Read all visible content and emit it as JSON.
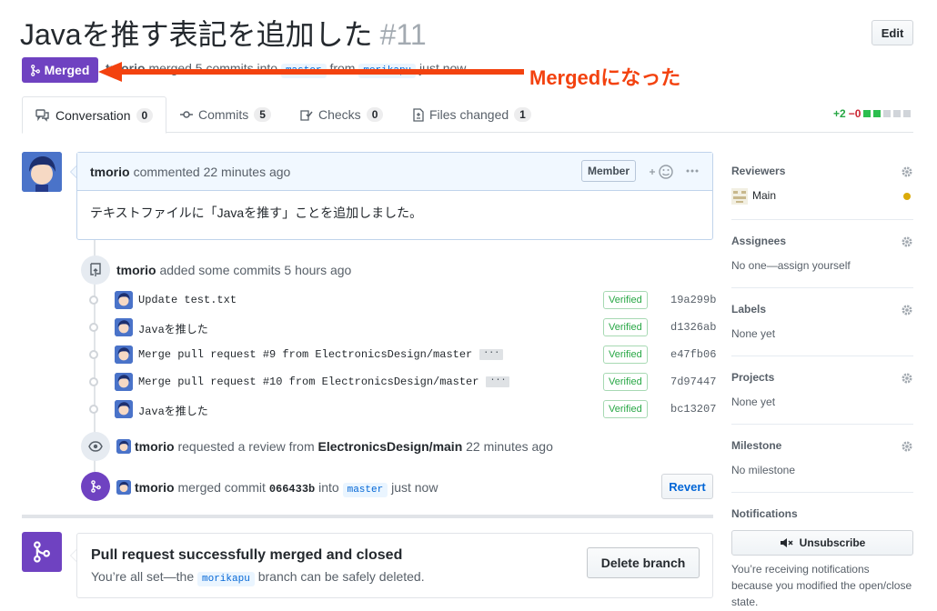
{
  "header": {
    "title": "Javaを推す表記を追加した",
    "number": "#11",
    "edit_label": "Edit",
    "state_label": "Merged",
    "meta": {
      "user": "tmorio",
      "action": "merged 5 commits into",
      "base_branch": "master",
      "from_word": "from",
      "head_branch": "morikapu",
      "time": "just now"
    }
  },
  "annotation": {
    "text": "Mergedになった",
    "color": "#f3420f"
  },
  "tabs": [
    {
      "label": "Conversation",
      "count": "0",
      "icon": "comment-discussion-icon"
    },
    {
      "label": "Commits",
      "count": "5",
      "icon": "git-commit-icon"
    },
    {
      "label": "Checks",
      "count": "0",
      "icon": "checklist-icon"
    },
    {
      "label": "Files changed",
      "count": "1",
      "icon": "file-diff-icon"
    }
  ],
  "diffstat": {
    "additions": "+2",
    "deletions": "−0"
  },
  "comment": {
    "author": "tmorio",
    "action": "commented 22 minutes ago",
    "badge": "Member",
    "body": "テキストファイルに「Javaを推す」ことを追加しました。"
  },
  "commits_event": {
    "author": "tmorio",
    "action": "added some commits 5 hours ago"
  },
  "commits": [
    {
      "message": "Update test.txt",
      "verified": "Verified",
      "sha": "19a299b",
      "has_ellipsis": false
    },
    {
      "message": "Javaを推した",
      "verified": "Verified",
      "sha": "d1326ab",
      "has_ellipsis": false
    },
    {
      "message": "Merge pull request #9 from ElectronicsDesign/master",
      "verified": "Verified",
      "sha": "e47fb06",
      "has_ellipsis": true
    },
    {
      "message": "Merge pull request #10 from ElectronicsDesign/master",
      "verified": "Verified",
      "sha": "7d97447",
      "has_ellipsis": true
    },
    {
      "message": "Javaを推した",
      "verified": "Verified",
      "sha": "bc13207",
      "has_ellipsis": false
    }
  ],
  "review_event": {
    "author": "tmorio",
    "action": "requested a review from",
    "team": "ElectronicsDesign/main",
    "time": "22 minutes ago"
  },
  "merge_event": {
    "author": "tmorio",
    "action": "merged commit",
    "sha": "066433b",
    "into": "into",
    "branch": "master",
    "time": "just now",
    "revert_label": "Revert"
  },
  "merged_box": {
    "title": "Pull request successfully merged and closed",
    "sub_prefix": "You’re all set—the",
    "branch": "morikapu",
    "sub_suffix": "branch can be safely deleted.",
    "delete_label": "Delete branch"
  },
  "sidebar": {
    "reviewers": {
      "heading": "Reviewers",
      "value": "Main"
    },
    "assignees": {
      "heading": "Assignees",
      "value": "No one—assign yourself"
    },
    "labels": {
      "heading": "Labels",
      "value": "None yet"
    },
    "projects": {
      "heading": "Projects",
      "value": "None yet"
    },
    "milestone": {
      "heading": "Milestone",
      "value": "No milestone"
    },
    "notifications": {
      "heading": "Notifications",
      "button_label": "Unsubscribe",
      "text": "You’re receiving notifications because you modified the open/close state."
    }
  },
  "colors": {
    "merged_purple": "#6f42c1",
    "link_blue": "#0366d6",
    "verified_green": "#28a745"
  }
}
